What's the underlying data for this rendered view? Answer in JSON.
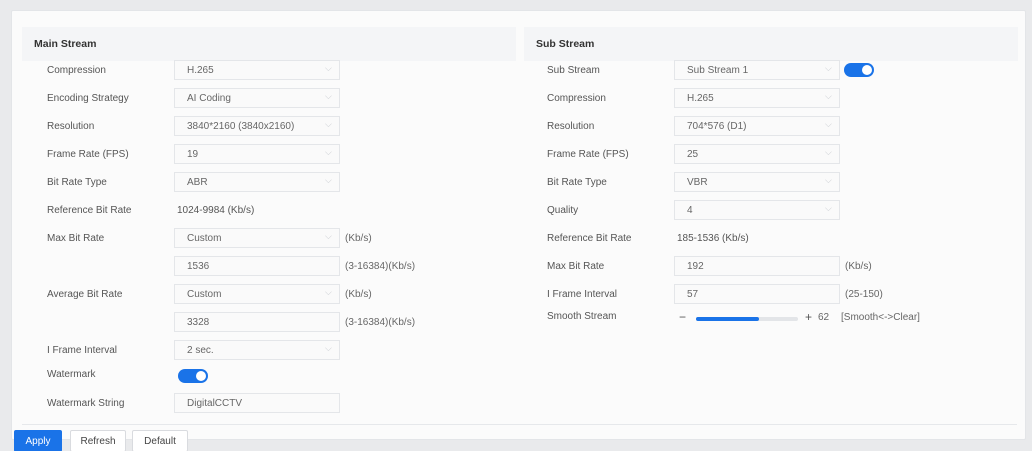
{
  "main": {
    "title": "Main Stream",
    "compression": {
      "label": "Compression",
      "value": "H.265"
    },
    "encoding": {
      "label": "Encoding Strategy",
      "value": "AI Coding"
    },
    "resolution": {
      "label": "Resolution",
      "value": "3840*2160 (3840x2160)"
    },
    "framerate": {
      "label": "Frame Rate (FPS)",
      "value": "19"
    },
    "bitratetype": {
      "label": "Bit Rate Type",
      "value": "ABR"
    },
    "refbitrate": {
      "label": "Reference Bit Rate",
      "value": "1024-9984 (Kb/s)"
    },
    "maxbitrate": {
      "label": "Max Bit Rate",
      "mode": "Custom",
      "unit": "(Kb/s)",
      "value": "1536",
      "range": "(3-16384)(Kb/s)"
    },
    "avgbitrate": {
      "label": "Average Bit Rate",
      "mode": "Custom",
      "unit": "(Kb/s)",
      "value": "3328",
      "range": "(3-16384)(Kb/s)"
    },
    "iframe": {
      "label": "I Frame Interval",
      "value": "2 sec."
    },
    "watermark": {
      "label": "Watermark",
      "enabled": true
    },
    "watermarkstring": {
      "label": "Watermark String",
      "value": "DigitalCCTV"
    }
  },
  "sub": {
    "title": "Sub Stream",
    "substream": {
      "label": "Sub Stream",
      "value": "Sub Stream 1",
      "enabled": true
    },
    "compression": {
      "label": "Compression",
      "value": "H.265"
    },
    "resolution": {
      "label": "Resolution",
      "value": "704*576 (D1)"
    },
    "framerate": {
      "label": "Frame Rate (FPS)",
      "value": "25"
    },
    "bitratetype": {
      "label": "Bit Rate Type",
      "value": "VBR"
    },
    "quality": {
      "label": "Quality",
      "value": "4"
    },
    "refbitrate": {
      "label": "Reference Bit Rate",
      "value": "185-1536 (Kb/s)"
    },
    "maxbitrate": {
      "label": "Max Bit Rate",
      "value": "192",
      "unit": "(Kb/s)"
    },
    "iframe": {
      "label": "I Frame Interval",
      "value": "57",
      "range": "(25-150)"
    },
    "smooth": {
      "label": "Smooth Stream",
      "minus": "−",
      "plus": "+",
      "value": "62",
      "hint": "[Smooth<->Clear]",
      "level": 0.62
    }
  },
  "actions": {
    "apply": "Apply",
    "refresh": "Refresh",
    "default": "Default"
  },
  "colors": {
    "accent": "#1a73e8"
  }
}
